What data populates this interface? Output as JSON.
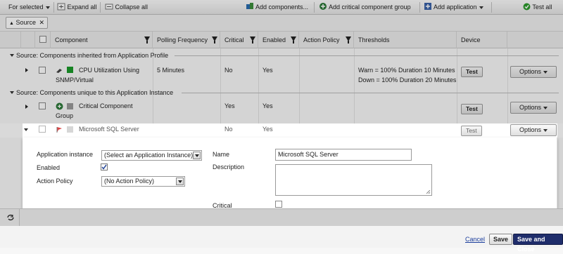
{
  "toolbar": {
    "for_selected": "For selected",
    "expand_all": "Expand all",
    "collapse_all": "Collapse all",
    "add_components": "Add components...",
    "add_critical_group": "Add critical component group",
    "add_application": "Add application",
    "test_all": "Test all"
  },
  "filter": {
    "chip_label": "Source"
  },
  "columns": {
    "component": "Component",
    "polling_frequency": "Polling Frequency",
    "critical": "Critical",
    "enabled": "Enabled",
    "action_policy": "Action Policy",
    "thresholds": "Thresholds",
    "device": "Device"
  },
  "groups": {
    "inherited": "Source: Components inherited from Application Profile",
    "unique": "Source: Components unique to this Application Instance"
  },
  "rows": {
    "cpu": {
      "name_line1": "CPU Utilization Using",
      "name_line2": "SNMP/Virtual",
      "polling": "5 Minutes",
      "critical": "No",
      "enabled": "Yes",
      "threshold_warn": "Warn = 100% Duration 10 Minutes",
      "threshold_down": "Down = 100% Duration 20 Minutes",
      "test": "Test",
      "options": "Options"
    },
    "critical_group": {
      "name_line1": "Critical Component",
      "name_line2": "Group",
      "critical": "Yes",
      "enabled": "Yes",
      "test": "Test",
      "options": "Options"
    },
    "sql": {
      "name": "Microsoft SQL Server",
      "critical": "No",
      "enabled": "Yes",
      "test": "Test",
      "options": "Options"
    }
  },
  "panel": {
    "app_instance_label": "Application instance",
    "app_instance_value": "(Select an Application Instance)",
    "enabled_label": "Enabled",
    "action_policy_label": "Action Policy",
    "action_policy_value": "(No Action Policy)",
    "name_label": "Name",
    "name_value": "Microsoft SQL Server",
    "description_label": "Description",
    "critical_label": "Critical"
  },
  "footer": {
    "cancel": "Cancel",
    "save": "Save",
    "save_close": "Save and Close"
  },
  "colors": {
    "green_icon": "#1a9a2a",
    "navy_button": "#1f2d6b",
    "link_blue": "#1a3d9c"
  }
}
